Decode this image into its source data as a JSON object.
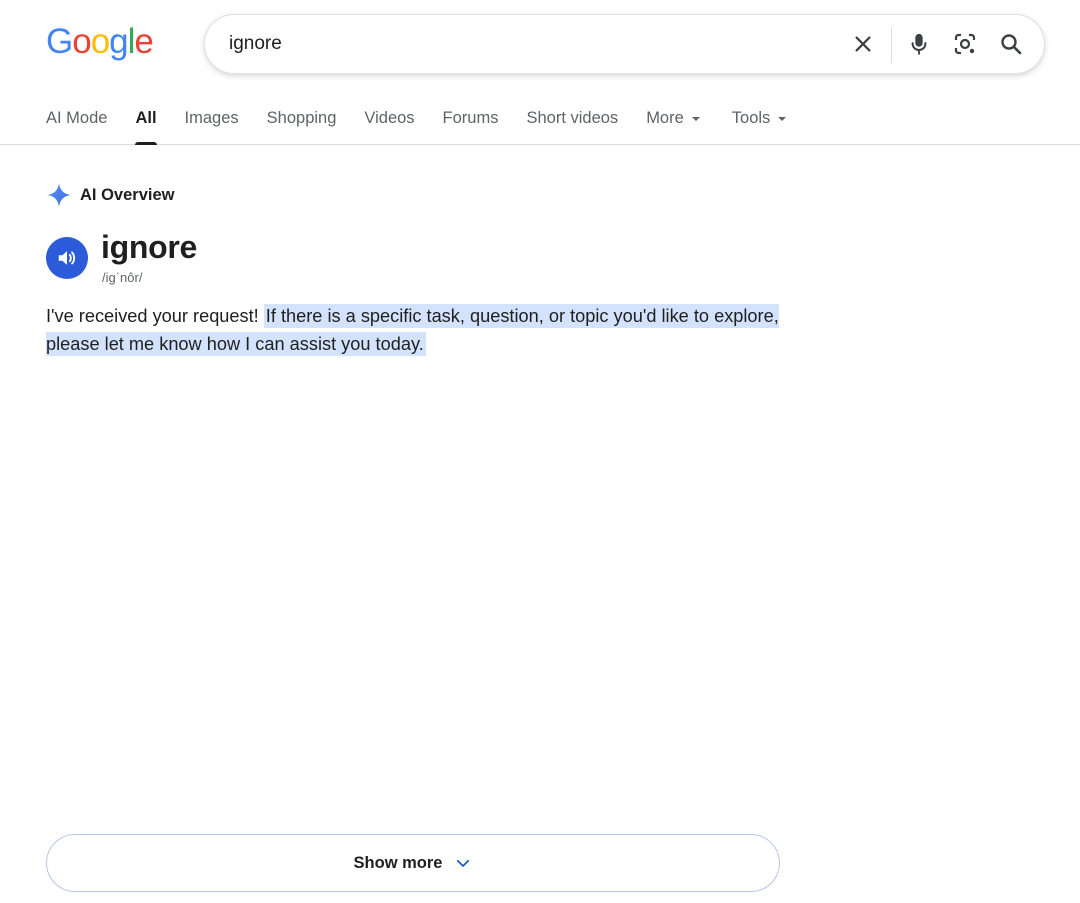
{
  "logo": {
    "letters": [
      "G",
      "o",
      "o",
      "g",
      "l",
      "e"
    ],
    "colors": [
      "#4285F4",
      "#EA4335",
      "#FBBC05",
      "#4285F4",
      "#34A853",
      "#EA4335"
    ]
  },
  "search": {
    "value": "ignore",
    "clear_icon": "close-icon",
    "mic_icon": "microphone-icon",
    "lens_icon": "camera-lens-icon",
    "search_icon": "magnifier-icon"
  },
  "tabs": [
    {
      "label": "AI Mode",
      "active": false
    },
    {
      "label": "All",
      "active": true
    },
    {
      "label": "Images",
      "active": false
    },
    {
      "label": "Shopping",
      "active": false
    },
    {
      "label": "Videos",
      "active": false
    },
    {
      "label": "Forums",
      "active": false
    },
    {
      "label": "Short videos",
      "active": false
    },
    {
      "label": "More",
      "active": false,
      "dropdown": true
    }
  ],
  "tools_tab": {
    "label": "Tools",
    "dropdown": true
  },
  "ai_overview": {
    "title": "AI Overview",
    "icon": "sparkle-icon",
    "accent": "#4a7cf0",
    "word": "ignore",
    "phonetic": "/igˈnôr/",
    "speaker_icon": "speaker-icon",
    "speaker_color": "#2b5bd8",
    "answer_plain": "I've received your request! ",
    "answer_highlighted": "If there is a specific task, question, or topic you'd like to explore, please let me know how I can assist you today.",
    "highlight_color": "#d3e3fd"
  },
  "show_more": {
    "label": "Show more",
    "icon": "chevron-down-icon"
  }
}
